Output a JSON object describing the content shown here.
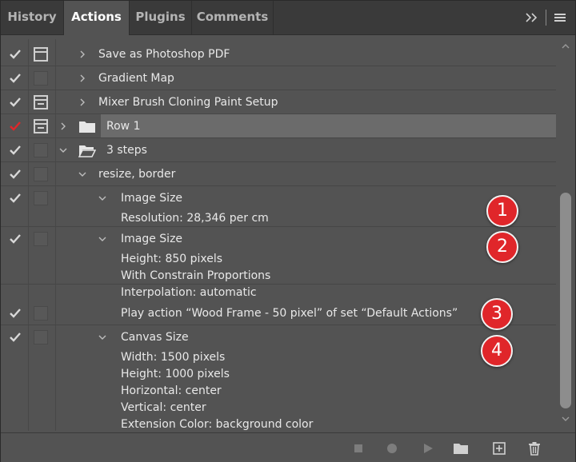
{
  "tabs": [
    {
      "label": "History",
      "active": false
    },
    {
      "label": "Actions",
      "active": true
    },
    {
      "label": "Plugins",
      "active": false
    },
    {
      "label": "Comments",
      "active": false
    }
  ],
  "rows": [
    {
      "label": "Save as Photoshop PDF"
    },
    {
      "label": "Gradient Map"
    },
    {
      "label": "Mixer Brush Cloning Paint Setup"
    },
    {
      "label": "Row 1"
    },
    {
      "label": "3 steps"
    },
    {
      "label": "resize, border"
    },
    {
      "label": "Image Size",
      "details": [
        "Resolution: 28,346 per cm"
      ]
    },
    {
      "label": "Image Size",
      "details": [
        "Height: 850 pixels",
        "With Constrain Proportions",
        "Interpolation: automatic"
      ]
    },
    {
      "label": "Play action “Wood Frame - 50 pixel” of set “Default Actions”"
    },
    {
      "label": "Canvas Size",
      "details": [
        "Width: 1500 pixels",
        "Height: 1000 pixels",
        "Horizontal: center",
        "Vertical: center",
        "Extension Color: background color"
      ]
    }
  ],
  "badges": [
    "1",
    "2",
    "3",
    "4"
  ],
  "colors": {
    "panel_bg": "#535353",
    "tab_bg": "#3a3a3a",
    "selected_row": "#6b6b6b",
    "check_default": "#d8d8d8",
    "check_alert": "#e0262a",
    "badge": "#e0262a"
  },
  "icons": {
    "tabbar": [
      "expand-panels-icon",
      "panel-menu-icon"
    ],
    "bottom": [
      "stop-icon",
      "record-icon",
      "play-icon",
      "new-set-icon",
      "new-action-icon",
      "delete-icon"
    ]
  }
}
